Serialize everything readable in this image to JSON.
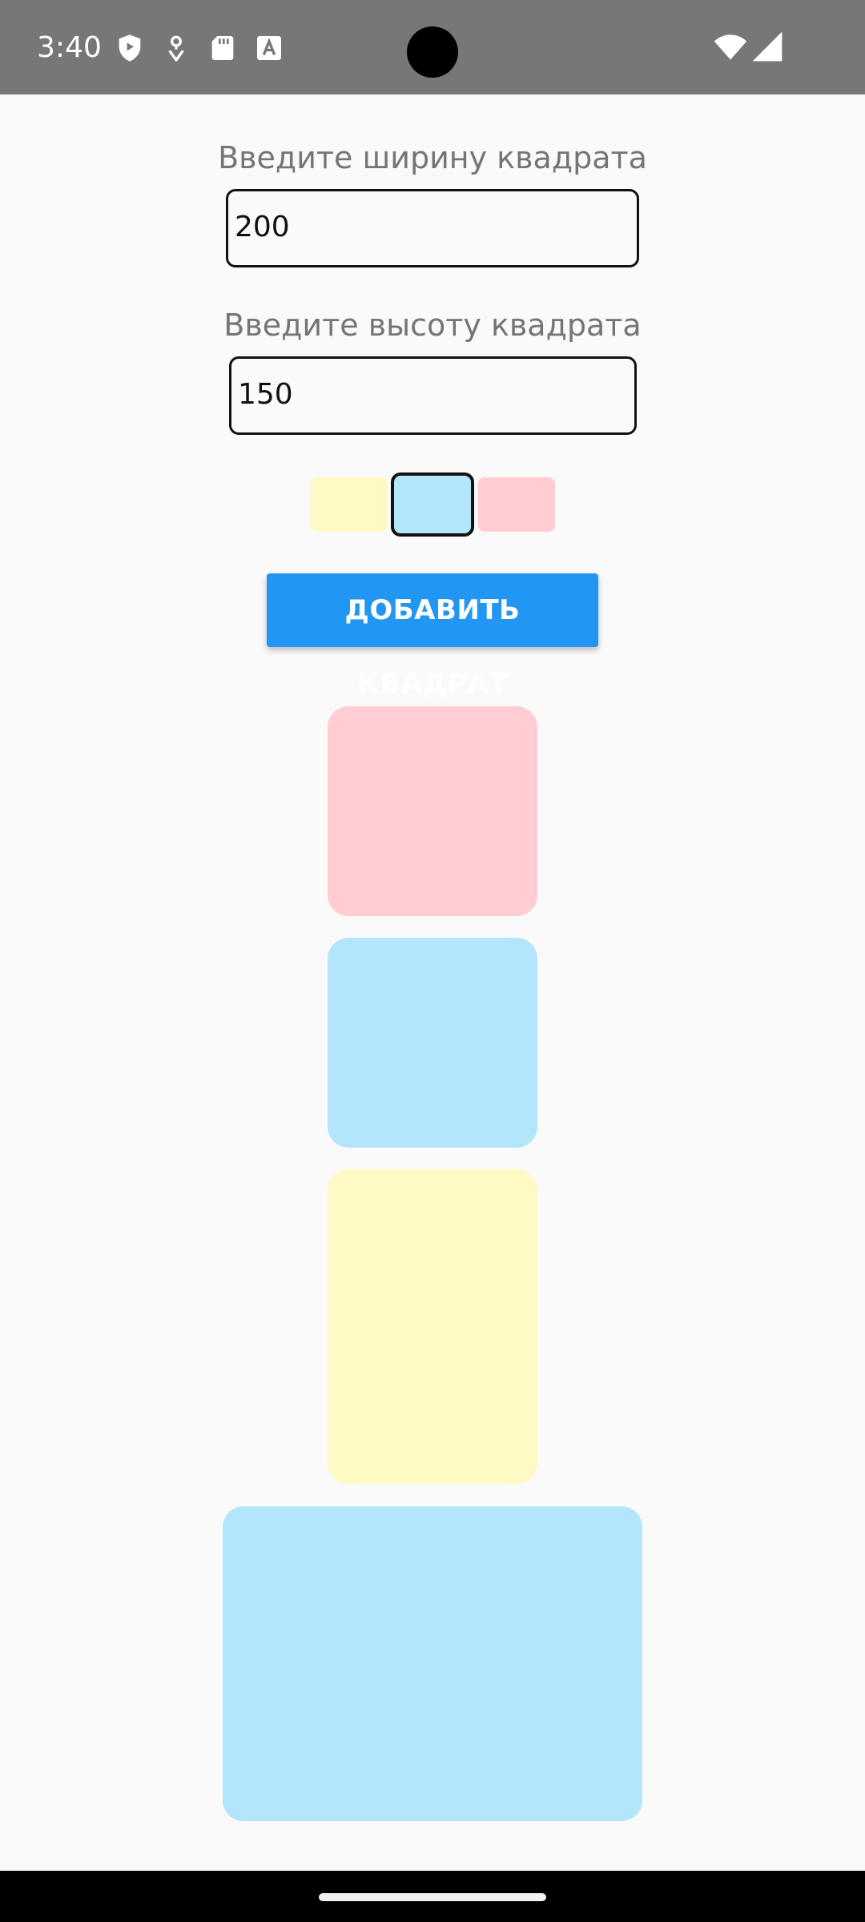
{
  "status_bar": {
    "time": "3:40",
    "icons": [
      "shield-icon",
      "location-pin-icon",
      "sd-card-icon",
      "font-a-icon",
      "wifi-icon",
      "signal-icon"
    ]
  },
  "form": {
    "width_label": "Введите ширину квадрата",
    "width_value": "200",
    "height_label": "Введите высоту квадрата",
    "height_value": "150"
  },
  "color_options": [
    {
      "name": "yellow",
      "color": "#fff9c4",
      "selected": false
    },
    {
      "name": "blue",
      "color": "#b3e5fc",
      "selected": true
    },
    {
      "name": "pink",
      "color": "#ffcdd2",
      "selected": false
    }
  ],
  "add_button_label": "ДОБАВИТЬ КВАДРАТ",
  "squares": [
    {
      "color": "#ffcdd2"
    },
    {
      "color": "#b3e5fc"
    },
    {
      "color": "#fff9c4"
    },
    {
      "color": "#b3e5fc"
    }
  ],
  "colors": {
    "accent": "#2196f3",
    "status_bar": "#777777",
    "background": "#fafafa"
  }
}
